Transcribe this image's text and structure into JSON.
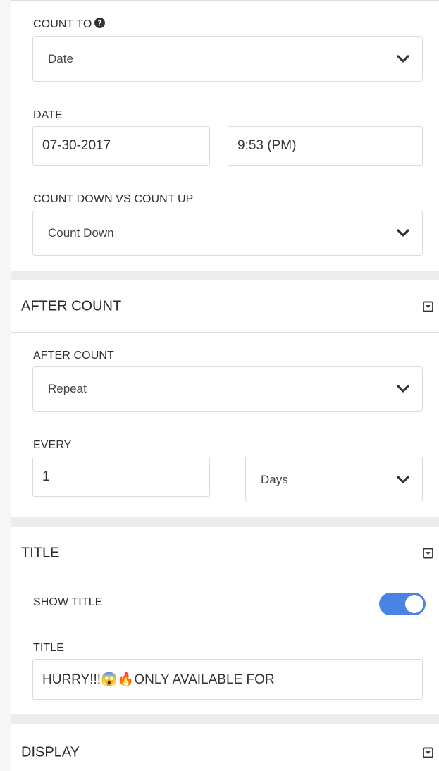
{
  "count_to": {
    "label": "COUNT TO",
    "help_icon": "question-circle-icon",
    "value": "Date"
  },
  "date": {
    "label": "DATE",
    "date_value": "07-30-2017",
    "time_value": "9:53 (PM)"
  },
  "count_direction": {
    "label": "COUNT DOWN VS COUNT UP",
    "value": "Count Down"
  },
  "after_count_section": {
    "title": "AFTER COUNT",
    "collapse_icon": "caret-square-down-icon",
    "after_count_label": "AFTER COUNT",
    "after_count_value": "Repeat",
    "every_label": "EVERY",
    "every_value": "1",
    "unit_value": "Days"
  },
  "title_section": {
    "title": "TITLE",
    "collapse_icon": "caret-square-down-icon",
    "show_title_label": "SHOW TITLE",
    "show_title_on": true,
    "title_label": "TITLE",
    "title_value": "HURRY!!!😱🔥ONLY AVAILABLE FOR"
  },
  "display_section": {
    "title": "DISPLAY",
    "collapse_icon": "caret-square-down-icon"
  },
  "colors": {
    "toggle_on": "#4a83e6",
    "divider_band": "#ececef",
    "border": "#d9dadf"
  }
}
